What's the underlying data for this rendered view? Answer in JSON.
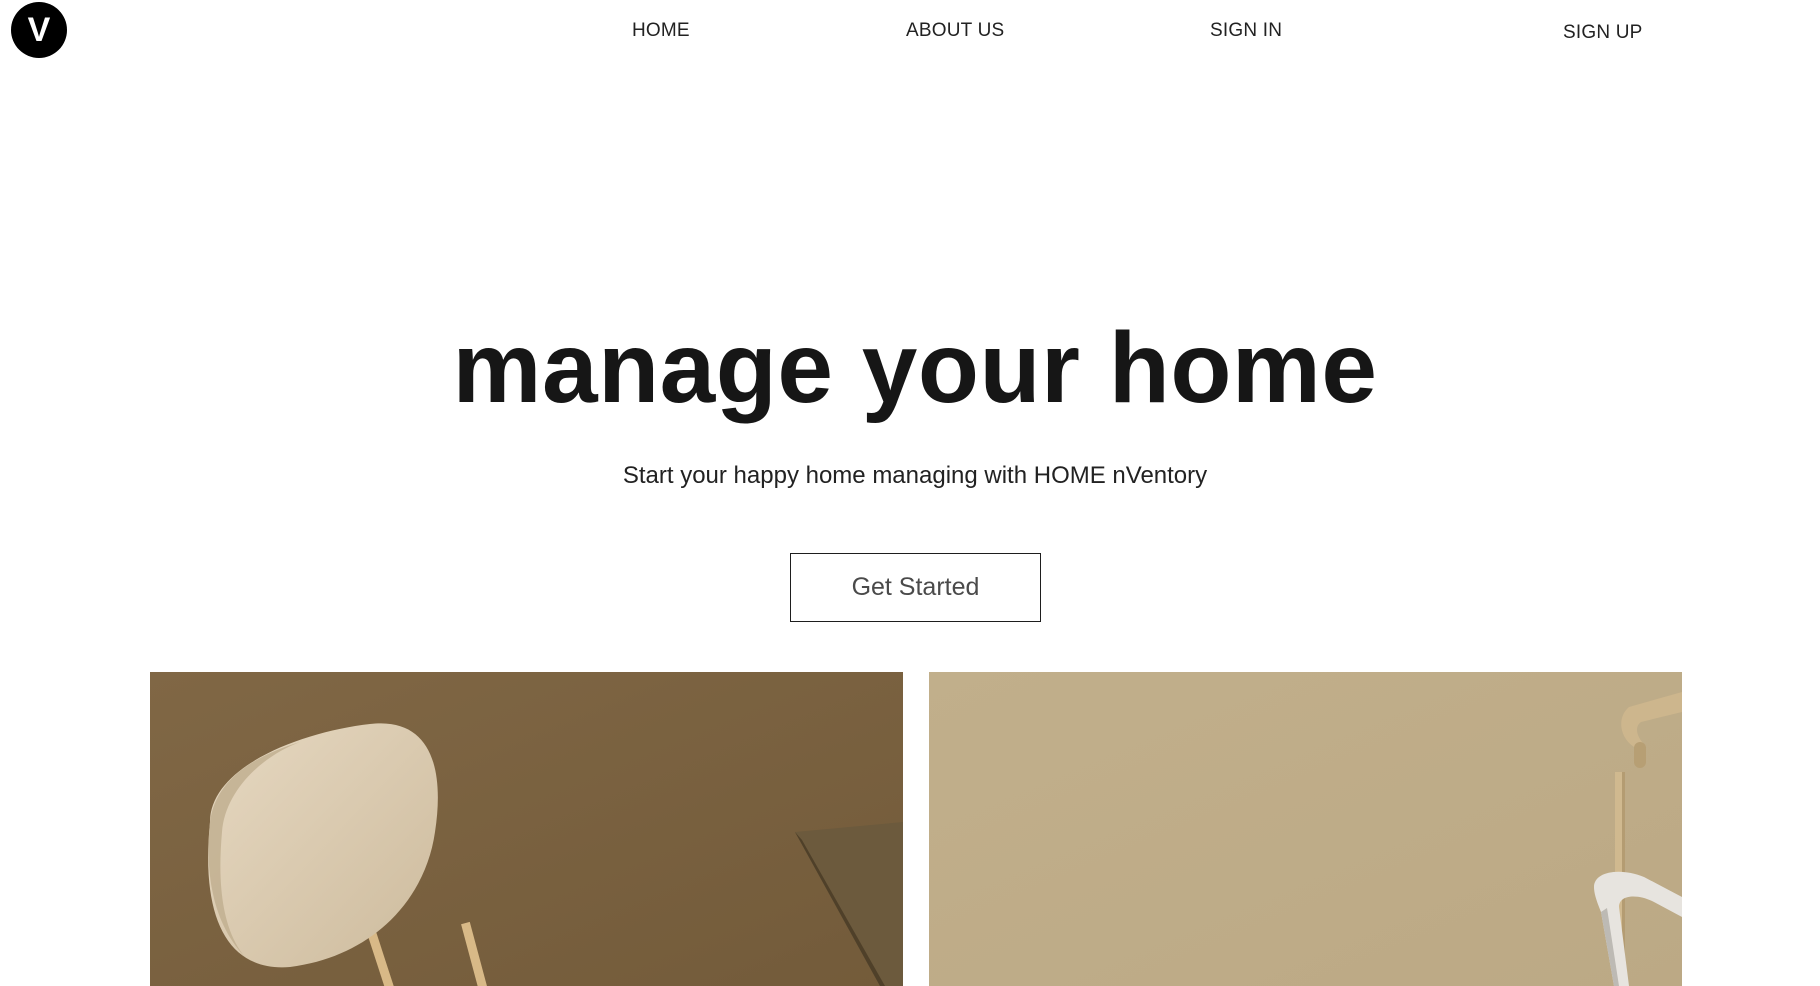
{
  "logo": {
    "letter": "V"
  },
  "nav": {
    "home": "HOME",
    "about": "ABOUT US",
    "sign_in": "SIGN IN",
    "sign_up": "SIGN UP"
  },
  "hero": {
    "title": "manage your home",
    "subtitle": "Start your happy home managing with HOME nVentory",
    "cta_label": "Get Started"
  },
  "images": {
    "left": {
      "subject": "chair-photo",
      "background_color": "#7b6441"
    },
    "right": {
      "subject": "chair-frame-photo",
      "background_color": "#c0ae88"
    }
  }
}
